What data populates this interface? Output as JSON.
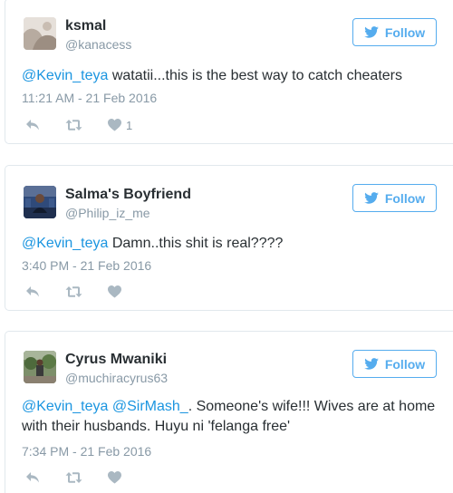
{
  "tweets": [
    {
      "name": "ksmal",
      "handle": "@kanacess",
      "follow_label": "Follow",
      "mention": "@Kevin_teya",
      "text": " watatii...this is the best way to catch cheaters",
      "timestamp": "11:21 AM - 21 Feb 2016",
      "like_count": "1"
    },
    {
      "name": "Salma's Boyfriend",
      "handle": "@Philip_iz_me",
      "follow_label": "Follow",
      "mention": "@Kevin_teya",
      "text": " Damn..this shit is real????",
      "timestamp": "3:40 PM - 21 Feb 2016"
    },
    {
      "name": "Cyrus Mwaniki",
      "handle": "@muchiracyrus63",
      "follow_label": "Follow",
      "mention": "@Kevin_teya",
      "mention2": "@SirMash_",
      "text": ". Someone's wife!!! Wives are at home with their husbands. Huyu ni 'felanga free'",
      "timestamp": "7:34 PM - 21 Feb 2016"
    }
  ],
  "colors": {
    "brand": "#55acee",
    "link": "#1b95e0",
    "muted": "#8899a6",
    "icon": "#aab8c2",
    "border": "#e1e8ed"
  },
  "icons": [
    "twitter-bird-icon",
    "reply-icon",
    "retweet-icon",
    "heart-icon"
  ]
}
